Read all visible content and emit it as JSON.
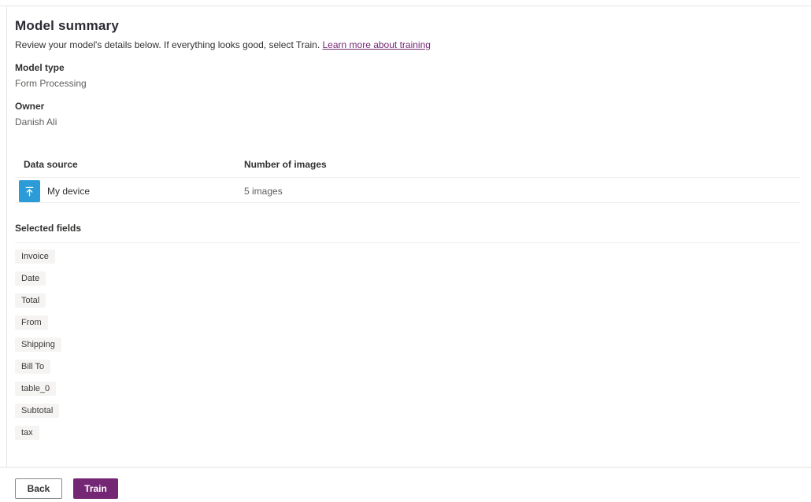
{
  "page": {
    "title": "Model summary",
    "subtitle": "Review your model's details below. If everything looks good, select Train.",
    "learn_more_link": "Learn more about training"
  },
  "details": [
    {
      "label": "Model type",
      "value": "Form Processing"
    },
    {
      "label": "Owner",
      "value": "Danish Ali"
    }
  ],
  "data_source_table": {
    "columns": [
      "Data source",
      "Number of images"
    ],
    "rows": [
      {
        "icon": "upload-icon",
        "source": "My device",
        "images": "5 images"
      }
    ]
  },
  "selected_fields": {
    "heading": "Selected fields",
    "fields": [
      "Invoice",
      "Date",
      "Total",
      "From",
      "Shipping",
      "Bill To",
      "table_0",
      "Subtotal",
      "tax"
    ]
  },
  "footer": {
    "back_label": "Back",
    "train_label": "Train"
  },
  "colors": {
    "accent_purple": "#742774",
    "link_purple": "#742774",
    "upload_icon_blue": "#2b9cd8",
    "divider_gray": "#f0efee"
  }
}
